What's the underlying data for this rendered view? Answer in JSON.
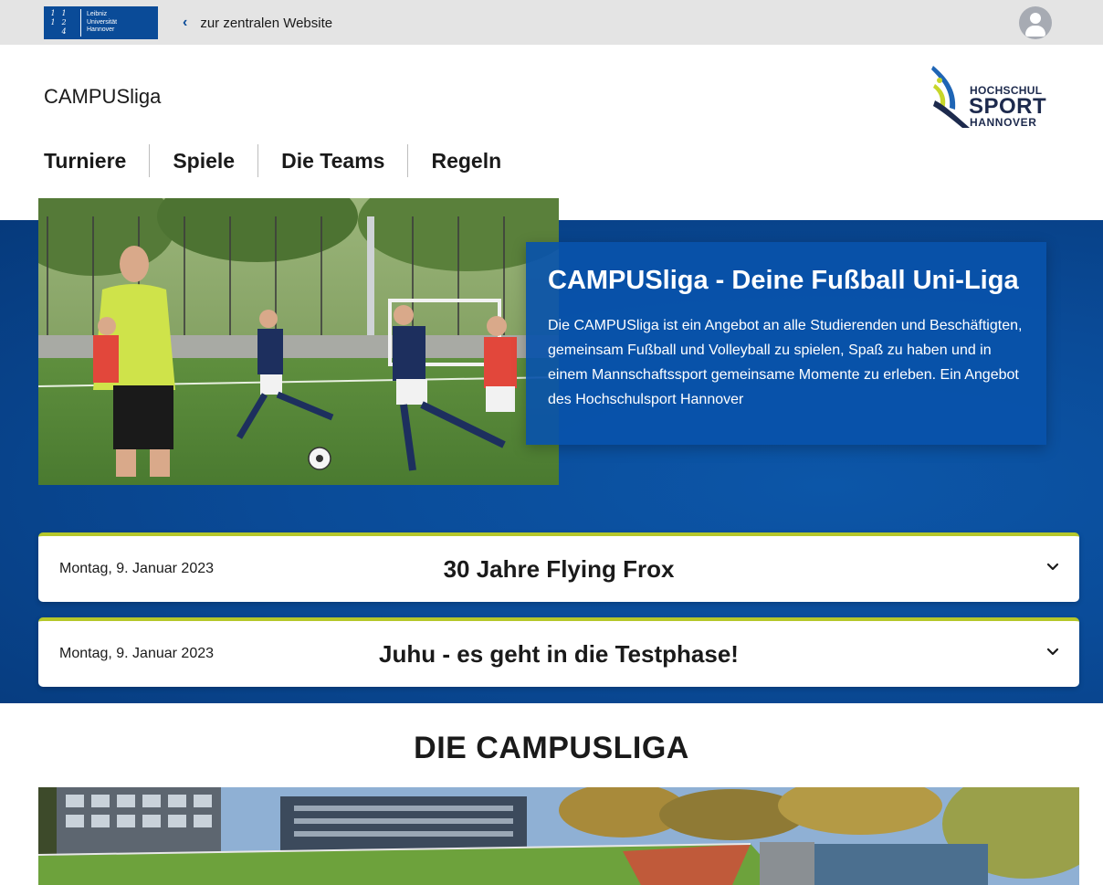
{
  "topbar": {
    "university_logo": {
      "digits": [
        "1",
        "1",
        "",
        "1",
        "2",
        "",
        "4",
        "",
        ""
      ],
      "lines": [
        "Leibniz",
        "Universität",
        "Hannover"
      ]
    },
    "back_link_label": "zur zentralen Website",
    "user_icon": "user-avatar-icon"
  },
  "header": {
    "site_title": "CAMPUSliga",
    "partner_logo": {
      "line1": "HOCHSCHUL",
      "line2": "SPORT",
      "line3": "HANNOVER"
    }
  },
  "nav": {
    "items": [
      {
        "label": "Turniere"
      },
      {
        "label": "Spiele"
      },
      {
        "label": "Die Teams"
      },
      {
        "label": "Regeln"
      }
    ]
  },
  "hero": {
    "heading": "CAMPUSliga - Deine Fußball Uni-Liga",
    "text": "Die CAMPUSliga ist ein Angebot an alle Studierenden und Beschäftigten, gemeinsam Fußball und Volleyball zu spielen, Spaß zu haben und in einem Mannschaftssport gemeinsame Momente zu erleben. Ein Angebot des Hochschulsport Hannover"
  },
  "news": [
    {
      "date": "Montag, 9. Januar 2023",
      "title": "30 Jahre Flying Frox"
    },
    {
      "date": "Montag, 9. Januar 2023",
      "title": "Juhu - es geht in die Testphase!"
    }
  ],
  "section": {
    "title": "DIE CAMPUSLIGA"
  },
  "colors": {
    "brand_blue": "#0a4b98",
    "accent_green": "#b5c72a",
    "topbar_gray": "#e4e4e4"
  }
}
